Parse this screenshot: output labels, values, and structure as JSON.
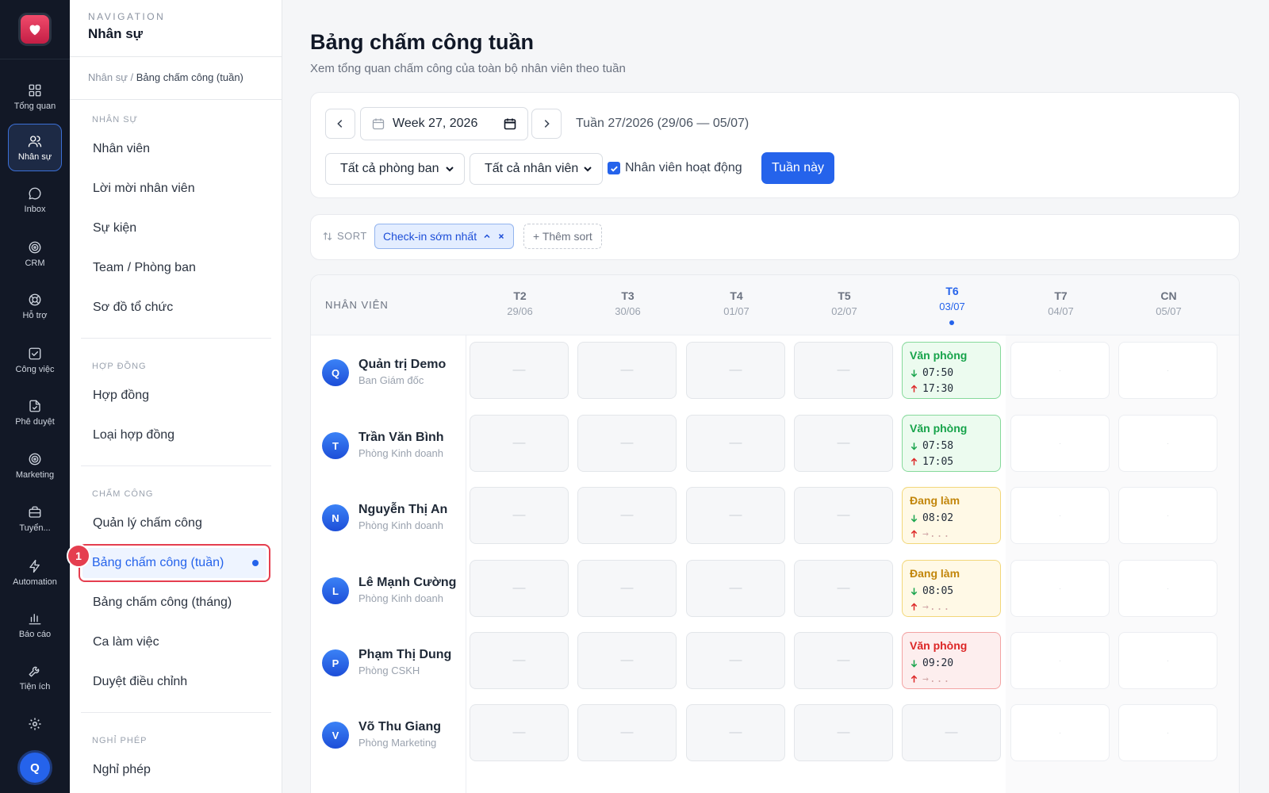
{
  "rail": {
    "items": [
      {
        "label": "Tổng quan",
        "icon": "grid-icon"
      },
      {
        "label": "Nhân sự",
        "icon": "users-icon",
        "active": true
      },
      {
        "label": "Inbox",
        "icon": "chat-icon"
      },
      {
        "label": "CRM",
        "icon": "target-icon"
      },
      {
        "label": "Hỗ trợ",
        "icon": "lifebuoy-icon"
      },
      {
        "label": "Công việc",
        "icon": "checkbox-icon"
      },
      {
        "label": "Phê duyệt",
        "icon": "document-check-icon"
      },
      {
        "label": "Marketing",
        "icon": "target-icon"
      },
      {
        "label": "Tuyển...",
        "icon": "briefcase-icon"
      },
      {
        "label": "Automation",
        "icon": "lightning-icon"
      },
      {
        "label": "Báo cáo",
        "icon": "bar-chart-icon"
      },
      {
        "label": "Tiện ích",
        "icon": "wrench-icon"
      }
    ],
    "avatar_initial": "Q"
  },
  "nav": {
    "eyebrow": "NAVIGATION",
    "title": "Nhân sự",
    "breadcrumb_parent": "Nhân sự /",
    "breadcrumb_current": "Bảng chấm công (tuần)",
    "sections": [
      {
        "title": "NHÂN SỰ",
        "items": [
          "Nhân viên",
          "Lời mời nhân viên",
          "Sự kiện",
          "Team / Phòng ban",
          "Sơ đồ tổ chức"
        ]
      },
      {
        "title": "HỢP ĐỒNG",
        "items": [
          "Hợp đồng",
          "Loại hợp đồng"
        ]
      },
      {
        "title": "CHẤM CÔNG",
        "items": [
          "Quản lý chấm công",
          "Bảng chấm công (tuần)",
          "Bảng chấm công (tháng)",
          "Ca làm việc",
          "Duyệt điều chỉnh"
        ]
      },
      {
        "title": "NGHỈ PHÉP",
        "items": [
          "Nghỉ phép"
        ]
      }
    ],
    "active_item": "Bảng chấm công (tuần)",
    "callout_number": "1"
  },
  "page": {
    "title": "Bảng chấm công tuần",
    "subtitle": "Xem tổng quan chấm công của toàn bộ nhân viên theo tuần"
  },
  "filters": {
    "week_value": "Week 27, 2026",
    "week_range": "Tuần 27/2026 (29/06 — 05/07)",
    "department_select": "Tất cả phòng ban",
    "employee_select": "Tất cả nhân viên",
    "active_checkbox_label": "Nhân viên hoạt động",
    "active_checkbox_checked": true,
    "this_week_button": "Tuần này"
  },
  "sort": {
    "label": "SORT",
    "chip_label": "Check-in sớm nhất",
    "add_label": "+ Thêm sort"
  },
  "grid": {
    "employee_header": "NHÂN VIÊN",
    "days": [
      {
        "name": "T2",
        "date": "29/06"
      },
      {
        "name": "T3",
        "date": "30/06"
      },
      {
        "name": "T4",
        "date": "01/07"
      },
      {
        "name": "T5",
        "date": "02/07"
      },
      {
        "name": "T6",
        "date": "03/07",
        "today": true
      },
      {
        "name": "T7",
        "date": "04/07",
        "weekend": true
      },
      {
        "name": "CN",
        "date": "05/07",
        "weekend": true
      }
    ],
    "empty_mark": "—",
    "weekend_mark": "·",
    "pending_mark": "→...",
    "status_colors": {
      "green": "#16a34a",
      "yellow": "#c2860b",
      "red": "#dc2626"
    },
    "rows": [
      {
        "initial": "Q",
        "name": "Quản trị Demo",
        "dept": "Ban Giám đốc",
        "today": {
          "status": "Văn phòng",
          "color": "green",
          "in": "07:50",
          "out": "17:30"
        }
      },
      {
        "initial": "T",
        "name": "Trần Văn Bình",
        "dept": "Phòng Kinh doanh",
        "today": {
          "status": "Văn phòng",
          "color": "green",
          "in": "07:58",
          "out": "17:05"
        }
      },
      {
        "initial": "N",
        "name": "Nguyễn Thị An",
        "dept": "Phòng Kinh doanh",
        "today": {
          "status": "Đang làm",
          "color": "yellow",
          "in": "08:02",
          "out": null
        }
      },
      {
        "initial": "L",
        "name": "Lê Mạnh Cường",
        "dept": "Phòng Kinh doanh",
        "today": {
          "status": "Đang làm",
          "color": "yellow",
          "in": "08:05",
          "out": null
        }
      },
      {
        "initial": "P",
        "name": "Phạm Thị Dung",
        "dept": "Phòng CSKH",
        "today": {
          "status": "Văn phòng",
          "color": "red",
          "in": "09:20",
          "out": null
        }
      },
      {
        "initial": "V",
        "name": "Võ Thu Giang",
        "dept": "Phòng Marketing",
        "today": null
      }
    ]
  }
}
